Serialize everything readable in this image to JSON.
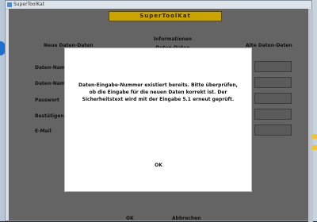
{
  "window": {
    "title": "SuperToolKat"
  },
  "heading": "SuperToolKat",
  "columns": {
    "left": "Neue Daten-Daten",
    "middle": "Informationen Daten-Daten",
    "right": "Alte Daten-Daten"
  },
  "rows": [
    {
      "label": "Daten-Name"
    },
    {
      "label": "Daten-Name"
    },
    {
      "label": "Passwort"
    },
    {
      "label": "Bestätigen"
    },
    {
      "label": "E-Mail"
    }
  ],
  "bottom": {
    "left_label": "OK",
    "right_label": "Abbrechen"
  },
  "dialog": {
    "message": "Daten-Eingabe-Nummer existiert bereits. Bitte überprüfen, ob die Eingabe für die neuen Daten korrekt ist. Der Sicherheitstext wird mit der Eingabe 5.1 erneut geprüft.",
    "ok_label": "OK"
  },
  "colors": {
    "heading_bg": "#c9a400",
    "client_bg": "#646464",
    "dialog_bg": "#ffffff"
  }
}
